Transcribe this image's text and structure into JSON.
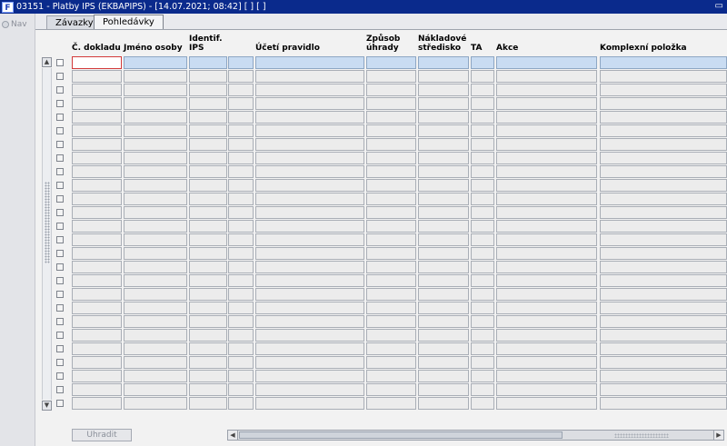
{
  "window": {
    "title": "03151 - Platby IPS (EKBAPIPS) - [14.07.2021; 08:42]  [ ] [ ]",
    "app_icon_glyph": "F",
    "restore_glyph": "▭"
  },
  "nav": {
    "label": "Nav"
  },
  "tabs": [
    {
      "label": "Závazky",
      "active": false
    },
    {
      "label": "Pohledávky",
      "active": true
    }
  ],
  "columns": [
    {
      "key": "doklad",
      "label": "Č. dokladu"
    },
    {
      "key": "jmeno",
      "label": "Jméno osoby"
    },
    {
      "key": "ips",
      "label": "Identif.\nIPS"
    },
    {
      "key": "blank",
      "label": ""
    },
    {
      "key": "pravidlo",
      "label": "Účetí pravidlo"
    },
    {
      "key": "uhrada",
      "label": "Způsob\núhrady"
    },
    {
      "key": "stredisko",
      "label": "Nákladové\nstředisko"
    },
    {
      "key": "ta",
      "label": "TA"
    },
    {
      "key": "akce",
      "label": "Akce"
    },
    {
      "key": "komplex",
      "label": "Komplexní položka"
    }
  ],
  "row_count": 26,
  "footer": {
    "pay_button": "Uhradit"
  },
  "scroll": {
    "up_glyph": "▲",
    "down_glyph": "▼",
    "left_glyph": "◀",
    "right_glyph": "▶"
  }
}
